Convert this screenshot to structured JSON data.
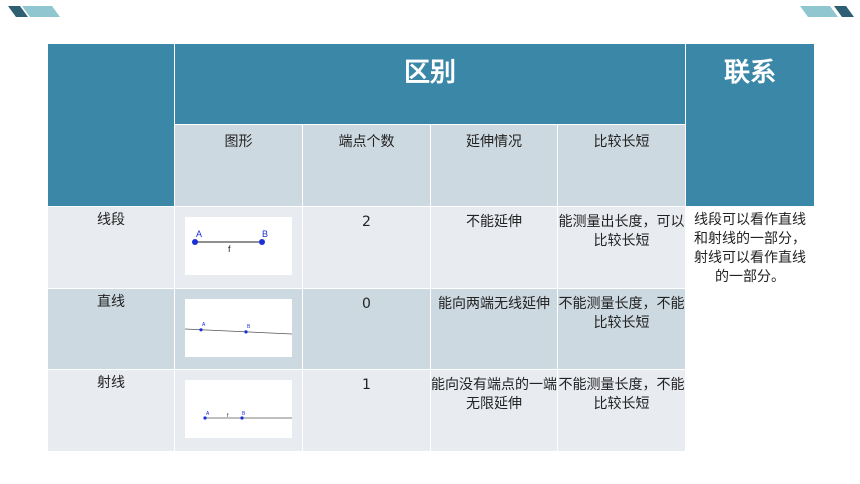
{
  "header": {
    "difference": "区别",
    "relation": "联系",
    "columns": [
      "图形",
      "端点个数",
      "延伸情况",
      "比较长短"
    ]
  },
  "rows": [
    {
      "name": "线段",
      "endpoints": "2",
      "extension": "不能延伸",
      "compare": "能测量出长度，可以 比较长短",
      "figure_labels": {
        "a": "A",
        "b": "B",
        "mid": "f"
      }
    },
    {
      "name": "直线",
      "endpoints": "0",
      "extension": "能向两端无线延伸",
      "compare": "不能测量长度，不能比较长短",
      "figure_labels": {
        "a": "A",
        "b": "B"
      }
    },
    {
      "name": "射线",
      "endpoints": "1",
      "extension": "能向没有端点的一端无限延伸",
      "compare": "不能测量长度，不能比较长短",
      "figure_labels": {
        "a": "A",
        "b": "B",
        "mid": "f"
      }
    }
  ],
  "relation_text": "线段可以看作直线和射线的一部分，射线可以看作直线的一部分。",
  "colors": {
    "header": "#3b87a8",
    "row_light": "#e8ebf0",
    "row_dark": "#cdd9e1",
    "deco_dark": "#2f5f73",
    "deco_light": "#8fc6cf"
  }
}
